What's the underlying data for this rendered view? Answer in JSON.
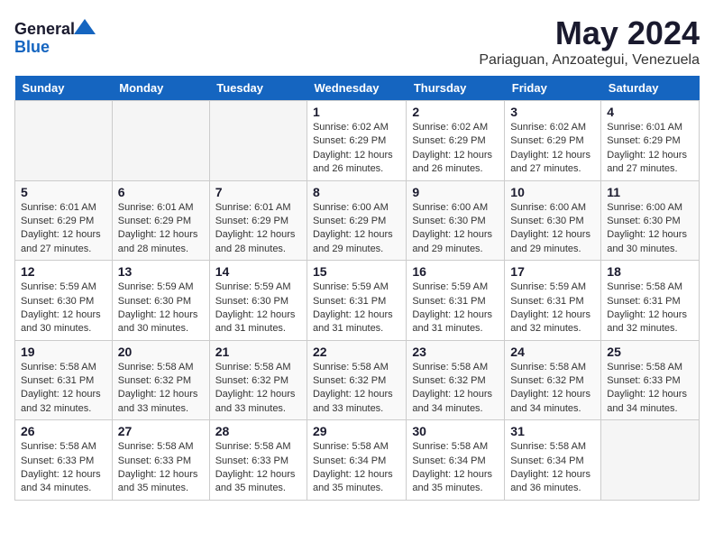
{
  "logo": {
    "line1": "General",
    "line2": "Blue"
  },
  "title": "May 2024",
  "subtitle": "Pariaguan, Anzoategui, Venezuela",
  "days_of_week": [
    "Sunday",
    "Monday",
    "Tuesday",
    "Wednesday",
    "Thursday",
    "Friday",
    "Saturday"
  ],
  "weeks": [
    [
      {
        "day": "",
        "info": ""
      },
      {
        "day": "",
        "info": ""
      },
      {
        "day": "",
        "info": ""
      },
      {
        "day": "1",
        "info": "Sunrise: 6:02 AM\nSunset: 6:29 PM\nDaylight: 12 hours\nand 26 minutes."
      },
      {
        "day": "2",
        "info": "Sunrise: 6:02 AM\nSunset: 6:29 PM\nDaylight: 12 hours\nand 26 minutes."
      },
      {
        "day": "3",
        "info": "Sunrise: 6:02 AM\nSunset: 6:29 PM\nDaylight: 12 hours\nand 27 minutes."
      },
      {
        "day": "4",
        "info": "Sunrise: 6:01 AM\nSunset: 6:29 PM\nDaylight: 12 hours\nand 27 minutes."
      }
    ],
    [
      {
        "day": "5",
        "info": "Sunrise: 6:01 AM\nSunset: 6:29 PM\nDaylight: 12 hours\nand 27 minutes."
      },
      {
        "day": "6",
        "info": "Sunrise: 6:01 AM\nSunset: 6:29 PM\nDaylight: 12 hours\nand 28 minutes."
      },
      {
        "day": "7",
        "info": "Sunrise: 6:01 AM\nSunset: 6:29 PM\nDaylight: 12 hours\nand 28 minutes."
      },
      {
        "day": "8",
        "info": "Sunrise: 6:00 AM\nSunset: 6:29 PM\nDaylight: 12 hours\nand 29 minutes."
      },
      {
        "day": "9",
        "info": "Sunrise: 6:00 AM\nSunset: 6:30 PM\nDaylight: 12 hours\nand 29 minutes."
      },
      {
        "day": "10",
        "info": "Sunrise: 6:00 AM\nSunset: 6:30 PM\nDaylight: 12 hours\nand 29 minutes."
      },
      {
        "day": "11",
        "info": "Sunrise: 6:00 AM\nSunset: 6:30 PM\nDaylight: 12 hours\nand 30 minutes."
      }
    ],
    [
      {
        "day": "12",
        "info": "Sunrise: 5:59 AM\nSunset: 6:30 PM\nDaylight: 12 hours\nand 30 minutes."
      },
      {
        "day": "13",
        "info": "Sunrise: 5:59 AM\nSunset: 6:30 PM\nDaylight: 12 hours\nand 30 minutes."
      },
      {
        "day": "14",
        "info": "Sunrise: 5:59 AM\nSunset: 6:30 PM\nDaylight: 12 hours\nand 31 minutes."
      },
      {
        "day": "15",
        "info": "Sunrise: 5:59 AM\nSunset: 6:31 PM\nDaylight: 12 hours\nand 31 minutes."
      },
      {
        "day": "16",
        "info": "Sunrise: 5:59 AM\nSunset: 6:31 PM\nDaylight: 12 hours\nand 31 minutes."
      },
      {
        "day": "17",
        "info": "Sunrise: 5:59 AM\nSunset: 6:31 PM\nDaylight: 12 hours\nand 32 minutes."
      },
      {
        "day": "18",
        "info": "Sunrise: 5:58 AM\nSunset: 6:31 PM\nDaylight: 12 hours\nand 32 minutes."
      }
    ],
    [
      {
        "day": "19",
        "info": "Sunrise: 5:58 AM\nSunset: 6:31 PM\nDaylight: 12 hours\nand 32 minutes."
      },
      {
        "day": "20",
        "info": "Sunrise: 5:58 AM\nSunset: 6:32 PM\nDaylight: 12 hours\nand 33 minutes."
      },
      {
        "day": "21",
        "info": "Sunrise: 5:58 AM\nSunset: 6:32 PM\nDaylight: 12 hours\nand 33 minutes."
      },
      {
        "day": "22",
        "info": "Sunrise: 5:58 AM\nSunset: 6:32 PM\nDaylight: 12 hours\nand 33 minutes."
      },
      {
        "day": "23",
        "info": "Sunrise: 5:58 AM\nSunset: 6:32 PM\nDaylight: 12 hours\nand 34 minutes."
      },
      {
        "day": "24",
        "info": "Sunrise: 5:58 AM\nSunset: 6:32 PM\nDaylight: 12 hours\nand 34 minutes."
      },
      {
        "day": "25",
        "info": "Sunrise: 5:58 AM\nSunset: 6:33 PM\nDaylight: 12 hours\nand 34 minutes."
      }
    ],
    [
      {
        "day": "26",
        "info": "Sunrise: 5:58 AM\nSunset: 6:33 PM\nDaylight: 12 hours\nand 34 minutes."
      },
      {
        "day": "27",
        "info": "Sunrise: 5:58 AM\nSunset: 6:33 PM\nDaylight: 12 hours\nand 35 minutes."
      },
      {
        "day": "28",
        "info": "Sunrise: 5:58 AM\nSunset: 6:33 PM\nDaylight: 12 hours\nand 35 minutes."
      },
      {
        "day": "29",
        "info": "Sunrise: 5:58 AM\nSunset: 6:34 PM\nDaylight: 12 hours\nand 35 minutes."
      },
      {
        "day": "30",
        "info": "Sunrise: 5:58 AM\nSunset: 6:34 PM\nDaylight: 12 hours\nand 35 minutes."
      },
      {
        "day": "31",
        "info": "Sunrise: 5:58 AM\nSunset: 6:34 PM\nDaylight: 12 hours\nand 36 minutes."
      },
      {
        "day": "",
        "info": ""
      }
    ]
  ]
}
